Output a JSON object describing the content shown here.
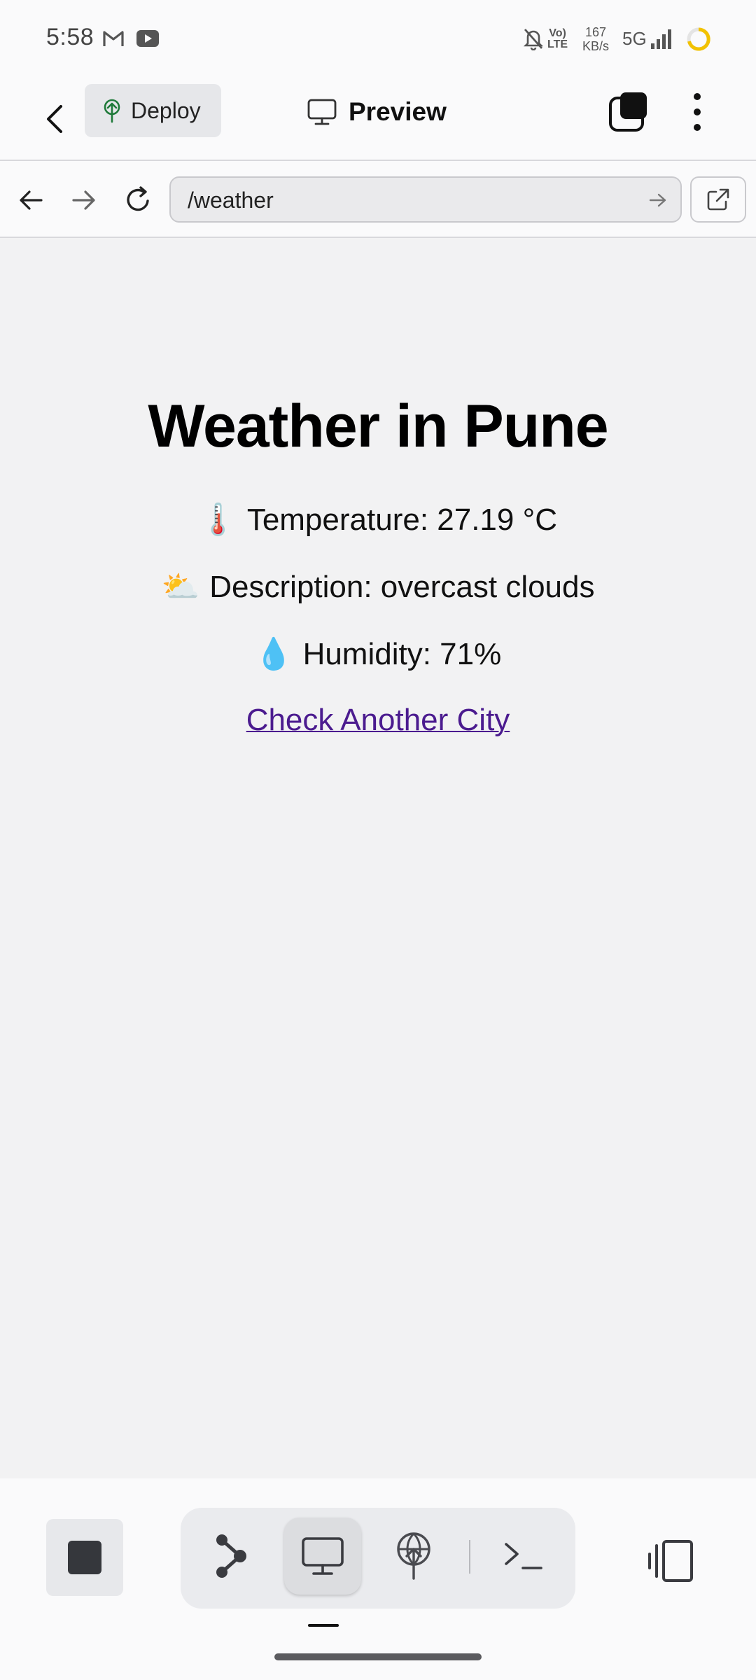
{
  "status_bar": {
    "time": "5:58",
    "lte_top": "Vo)",
    "lte_bottom": "LTE",
    "speed_value": "167",
    "speed_unit": "KB/s",
    "network": "5G"
  },
  "header": {
    "deploy_label": "Deploy",
    "preview_label": "Preview"
  },
  "browser": {
    "url": "/weather"
  },
  "page": {
    "heading": "Weather in Pune",
    "temperature_emoji": "🌡️",
    "temperature": "Temperature: 27.19 °C",
    "description_emoji": "⛅",
    "description": "Description: overcast clouds",
    "humidity_emoji": "💧",
    "humidity": "Humidity: 71%",
    "link": "Check Another City"
  },
  "colors": {
    "link": "#4b1b8f",
    "deploy_icon": "#1f7a3a",
    "battery_ring": "#f2c200"
  },
  "icons": {
    "back": "chevron-left-icon",
    "deploy": "deploy-tree-icon",
    "preview": "monitor-icon",
    "tabs": "tabs-icon",
    "more": "more-vertical-icon",
    "nav_back": "arrow-left-icon",
    "nav_forward": "arrow-right-icon",
    "reload": "reload-icon",
    "go": "arrow-right-small-icon",
    "external": "external-link-icon",
    "stop": "stop-icon",
    "graph": "graph-icon",
    "deploy_tb": "deploy-icon",
    "terminal": "terminal-icon",
    "layout": "layout-icon"
  }
}
